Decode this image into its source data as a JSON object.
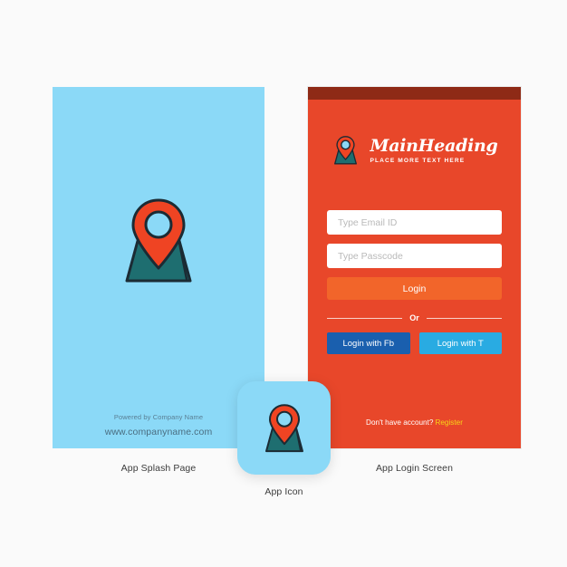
{
  "colors": {
    "page_background": "#FAFAFA",
    "splash_background": "#8BD9F7",
    "login_background": "#E8472A",
    "status_bar": "#8E2A16",
    "login_button": "#F2652A",
    "facebook_button": "#1A5FAE",
    "twitter_button": "#29ABE2",
    "register_link": "#F7D417",
    "map_teal": "#1E6E70",
    "pin_orange": "#EF4423",
    "outline_dark": "#1B2B34"
  },
  "splash": {
    "logo_icon": "map-pin-logo-icon",
    "powered_by": "Powered by Company Name",
    "website": "www.companyname.com",
    "caption": "App Splash Page"
  },
  "app_icon": {
    "icon": "map-pin-logo-icon",
    "caption": "App Icon"
  },
  "login": {
    "caption": "App Login Screen",
    "header": {
      "logo_icon": "map-pin-logo-icon",
      "title": "MainHeading",
      "subtitle": "PLACE MORE TEXT HERE"
    },
    "form": {
      "email_placeholder": "Type Email ID",
      "email_value": "",
      "passcode_placeholder": "Type Passcode",
      "passcode_value": "",
      "login_label": "Login"
    },
    "divider_label": "Or",
    "social": {
      "facebook_label": "Login with Fb",
      "twitter_label": "Login with T"
    },
    "register": {
      "prompt": "Don't have account?",
      "link_label": "Register"
    }
  }
}
